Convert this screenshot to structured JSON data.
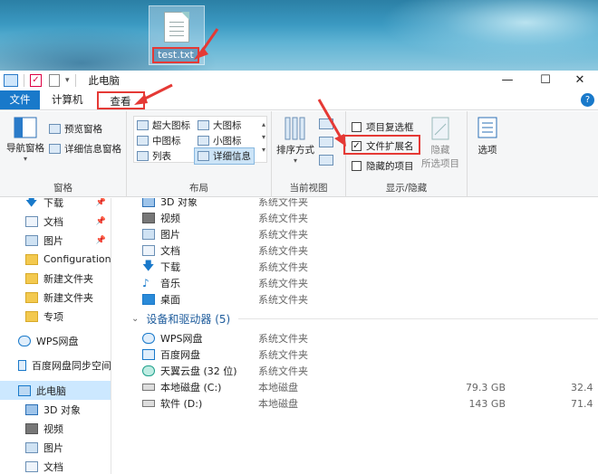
{
  "desktop": {
    "file_label": "test.txt"
  },
  "window": {
    "title": "此电脑",
    "controls": {
      "minimize": "—",
      "maximize": "☐",
      "close": "✕"
    }
  },
  "tabs": {
    "file": "文件",
    "computer": "计算机",
    "view": "查看",
    "help": "?"
  },
  "ribbon": {
    "pane": {
      "nav_pane": "导航窗格",
      "preview_pane": "预览窗格",
      "details_pane": "详细信息窗格",
      "group_label": "窗格"
    },
    "layout": {
      "items": [
        "超大图标",
        "大图标",
        "中图标",
        "小图标",
        "列表",
        "详细信息"
      ],
      "selected": "详细信息",
      "group_label": "布局"
    },
    "current_view": {
      "sort_by": "排序方式",
      "group_label": "当前视图"
    },
    "show_hide": {
      "item_checkboxes": "项目复选框",
      "file_extensions": "文件扩展名",
      "hidden_items": "隐藏的项目",
      "hide_selected_top": "隐藏",
      "hide_selected_bottom": "所选项目",
      "options": "选项",
      "group_label": "显示/隐藏",
      "file_extensions_checked": true
    }
  },
  "nav": {
    "items": [
      {
        "label": "下载",
        "icon": "download-icon",
        "pinned": true
      },
      {
        "label": "文档",
        "icon": "document-icon",
        "pinned": true
      },
      {
        "label": "图片",
        "icon": "picture-icon",
        "pinned": true
      },
      {
        "label": "Configuration",
        "icon": "folder-icon"
      },
      {
        "label": "新建文件夹",
        "icon": "folder-icon"
      },
      {
        "label": "新建文件夹",
        "icon": "folder-icon"
      },
      {
        "label": "专项",
        "icon": "folder-icon"
      },
      {
        "label": "WPS网盘",
        "icon": "cloud-icon"
      },
      {
        "label": "百度网盘同步空间",
        "icon": "baidu-icon"
      },
      {
        "label": "此电脑",
        "icon": "computer-icon",
        "selected": true
      },
      {
        "label": "3D 对象",
        "icon": "cube-icon"
      },
      {
        "label": "视频",
        "icon": "video-icon"
      },
      {
        "label": "图片",
        "icon": "picture-icon"
      },
      {
        "label": "文档",
        "icon": "document-icon"
      }
    ]
  },
  "content": {
    "folders": [
      {
        "name": "3D 对象",
        "type": "系统文件夹",
        "icon": "cube-icon"
      },
      {
        "name": "视频",
        "type": "系统文件夹",
        "icon": "video-icon"
      },
      {
        "name": "图片",
        "type": "系统文件夹",
        "icon": "picture-icon"
      },
      {
        "name": "文档",
        "type": "系统文件夹",
        "icon": "document-icon"
      },
      {
        "name": "下载",
        "type": "系统文件夹",
        "icon": "download-icon"
      },
      {
        "name": "音乐",
        "type": "系统文件夹",
        "icon": "music-icon"
      },
      {
        "name": "桌面",
        "type": "系统文件夹",
        "icon": "desktop-icon"
      }
    ],
    "devices_header": "设备和驱动器 (5)",
    "devices": [
      {
        "name": "WPS网盘",
        "type": "系统文件夹",
        "size": "",
        "free": "",
        "icon": "cloud-icon"
      },
      {
        "name": "百度网盘",
        "type": "系统文件夹",
        "size": "",
        "free": "",
        "icon": "baidu-icon"
      },
      {
        "name": "天翼云盘 (32 位)",
        "type": "系统文件夹",
        "size": "",
        "free": "",
        "icon": "tianyi-icon"
      },
      {
        "name": "本地磁盘 (C:)",
        "type": "本地磁盘",
        "size": "79.3 GB",
        "free": "32.4",
        "icon": "drive-icon"
      },
      {
        "name": "软件 (D:)",
        "type": "本地磁盘",
        "size": "143 GB",
        "free": "71.4",
        "icon": "drive-icon"
      }
    ]
  },
  "colors": {
    "accent": "#1979ca",
    "highlight_red": "#e53935",
    "selected_bg": "#cce8ff"
  }
}
